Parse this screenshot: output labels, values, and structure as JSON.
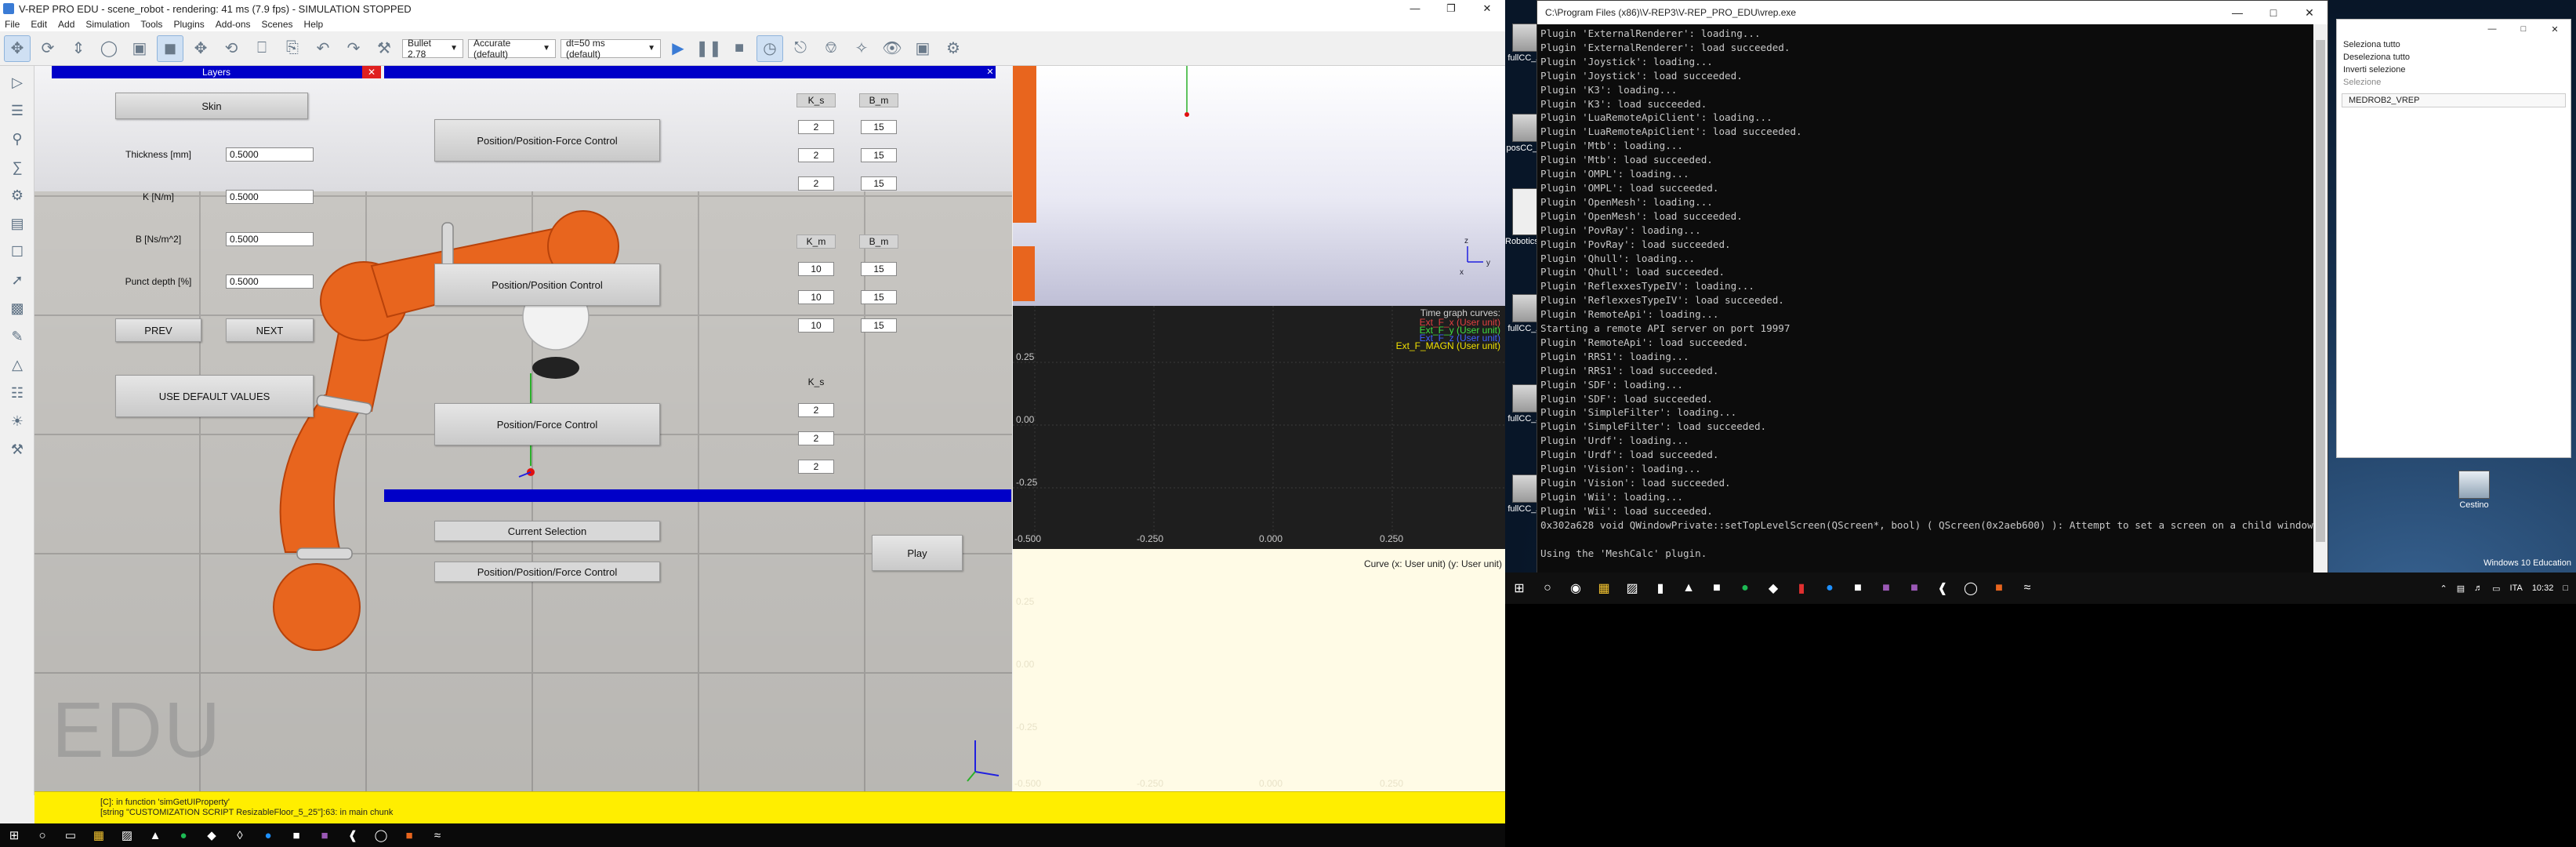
{
  "vrep": {
    "title": "V-REP PRO EDU - scene_robot - rendering: 41 ms (7.9 fps) - SIMULATION STOPPED",
    "menu": [
      "File",
      "Edit",
      "Add",
      "Simulation",
      "Tools",
      "Plugins",
      "Add-ons",
      "Scenes",
      "Help"
    ],
    "engine": "Bullet 2.78",
    "accuracy": "Accurate (default)",
    "timestep": "dt=50 ms (default)",
    "layers_title": "Layers",
    "skin_button": "Skin",
    "params": [
      {
        "label": "Thickness [mm]",
        "value": "0.5000"
      },
      {
        "label": "K [N/m]",
        "value": "0.5000"
      },
      {
        "label": "B [Ns/m^2]",
        "value": "0.5000"
      },
      {
        "label": "Punct depth [%]",
        "value": "0.5000"
      }
    ],
    "prev_button": "PREV",
    "next_button": "NEXT",
    "default_button": "USE DEFAULT VALUES",
    "control_buttons": [
      "Position/Position-Force Control",
      "Position/Position Control",
      "Position/Force Control"
    ],
    "col_headers": {
      "ks": "K_s",
      "bs": "B_m",
      "km": "K_m",
      "bm": "B_m",
      "ks2": "K_s"
    },
    "group1": [
      [
        "2",
        "15"
      ],
      [
        "2",
        "15"
      ],
      [
        "2",
        "15"
      ]
    ],
    "group2": [
      [
        "10",
        "15"
      ],
      [
        "10",
        "15"
      ],
      [
        "10",
        "15"
      ]
    ],
    "group3": [
      "2",
      "2",
      "2"
    ],
    "current_selection_label": "Current Selection",
    "current_selection_value": "Position/Position/Force Control",
    "play_button": "Play",
    "edu_watermark": "EDU",
    "graph": {
      "title": "Time graph curves:",
      "curves": [
        "Ext_F_x (User unit)",
        "Ext_F_y (User unit)",
        "Ext_F_z (User unit)",
        "Ext_F_MAGN (User unit)"
      ],
      "y_ticks": [
        "0.25",
        "0.00",
        "-0.25"
      ],
      "x_ticks": [
        "-0.500",
        "-0.250",
        "0.000",
        "0.250"
      ],
      "curve_xy_title": "Curve (x: User unit) (y: User unit)",
      "y_ticks2": [
        "0.25",
        "0.00",
        "-0.25",
        "-0.500"
      ],
      "x_ticks2": [
        "-0.500",
        "-0.250",
        "0.000",
        "0.250"
      ]
    },
    "status_lines": [
      "[C]: in function 'simGetUIProperty'",
      "[string \"CUSTOMIZATION SCRIPT ResizableFloor_5_25\"]:63: in main chunk"
    ],
    "colors": {
      "ui_blue": "#0000c8",
      "status_yellow": "#ffee00",
      "robot_orange": "#e8651e"
    }
  },
  "desktop": {
    "icons": [
      {
        "label": "fullCC_AN"
      },
      {
        "label": "posCC_AN"
      },
      {
        "label": "RoboticsA..."
      },
      {
        "label": "fullCC_AN"
      },
      {
        "label": "fullCC_AN"
      },
      {
        "label": "fullCC_AN"
      },
      {
        "label": "fullCC_AN"
      }
    ],
    "console_title": "C:\\Program Files (x86)\\V-REP3\\V-REP_PRO_EDU\\vrep.exe",
    "console_lines": [
      "Plugin 'ExternalRenderer': loading...",
      "Plugin 'ExternalRenderer': load succeeded.",
      "Plugin 'Joystick': loading...",
      "Plugin 'Joystick': load succeeded.",
      "Plugin 'K3': loading...",
      "Plugin 'K3': load succeeded.",
      "Plugin 'LuaRemoteApiClient': loading...",
      "Plugin 'LuaRemoteApiClient': load succeeded.",
      "Plugin 'Mtb': loading...",
      "Plugin 'Mtb': load succeeded.",
      "Plugin 'OMPL': loading...",
      "Plugin 'OMPL': load succeeded.",
      "Plugin 'OpenMesh': loading...",
      "Plugin 'OpenMesh': load succeeded.",
      "Plugin 'PovRay': loading...",
      "Plugin 'PovRay': load succeeded.",
      "Plugin 'Qhull': loading...",
      "Plugin 'Qhull': load succeeded.",
      "Plugin 'ReflexxesTypeIV': loading...",
      "Plugin 'ReflexxesTypeIV': load succeeded.",
      "Plugin 'RemoteApi': loading...",
      "Starting a remote API server on port 19997",
      "Plugin 'RemoteApi': load succeeded.",
      "Plugin 'RRS1': loading...",
      "Plugin 'RRS1': load succeeded.",
      "Plugin 'SDF': loading...",
      "Plugin 'SDF': load succeeded.",
      "Plugin 'SimpleFilter': loading...",
      "Plugin 'SimpleFilter': load succeeded.",
      "Plugin 'Urdf': loading...",
      "Plugin 'Urdf': load succeeded.",
      "Plugin 'Vision': loading...",
      "Plugin 'Vision': load succeeded.",
      "Plugin 'Wii': loading...",
      "Plugin 'Wii': load succeeded.",
      "0x302a628 void QWindowPrivate::setTopLevelScreen(QScreen*, bool) ( QScreen(0x2aeb600) ): Attempt to set a screen on a child window.",
      "",
      "Using the 'MeshCalc' plugin."
    ],
    "explorer_items": [
      "Seleziona tutto",
      "Deseleziona tutto",
      "Inverti selezione",
      "Selezione",
      "MEDROB2_VREP"
    ],
    "recycle_label": "Cestino",
    "windows_edition": "Windows 10 Education",
    "tray_lang": "ITA",
    "tray_time": "10:32"
  }
}
